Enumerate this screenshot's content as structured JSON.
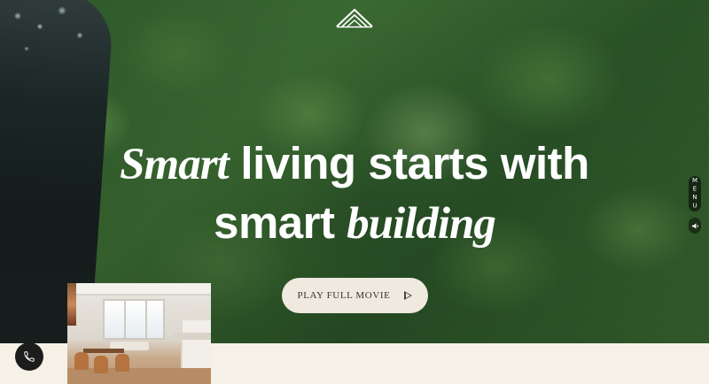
{
  "hero": {
    "headline_line1_serif": "Smart",
    "headline_line1_sans": " living starts with",
    "headline_line2_sans": "smart ",
    "headline_line2_serif": "building"
  },
  "play_button": {
    "label": "PLAY FULL MOVIE",
    "icon": "play-icon"
  },
  "side_controls": {
    "menu_label": "MENU",
    "sound_icon": "speaker-icon"
  },
  "call_button": {
    "icon": "phone-icon"
  },
  "logo": {
    "icon": "pyramid-logo-icon"
  },
  "colors": {
    "hero_text": "#ffffff",
    "button_bg": "#efe9df",
    "page_bg": "#f6f1e6",
    "call_bg": "#1c1c1c"
  }
}
